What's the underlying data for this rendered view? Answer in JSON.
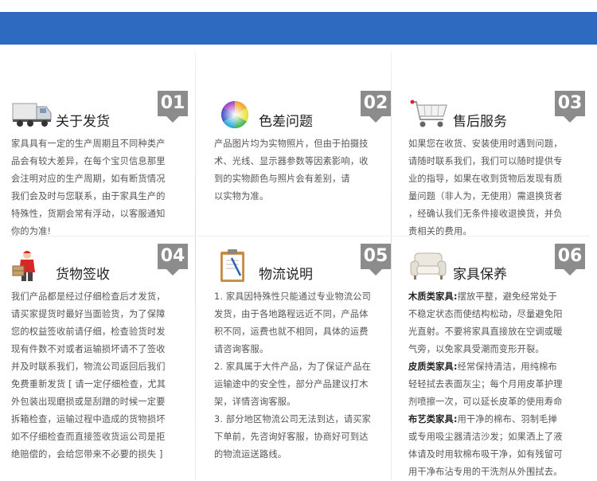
{
  "cards": [
    {
      "num": "01",
      "title": "关于发货",
      "icon": "truck-icon",
      "lines": [
        "家具具有一定的生产周期且不同种类产",
        "品会有较大差异，在每个宝贝信息那里",
        "会注明对应的生产周期，如有断货情况",
        "我们会及时与您联系，由于家具生产的",
        "特殊性，货期会常有浮动，以客服通知",
        "你的为准!"
      ]
    },
    {
      "num": "02",
      "title": "色差问题",
      "icon": "color-wheel-icon",
      "lines": [
        "产品图片均为实物照片，但由于拍摄技",
        "术、光线、显示器参数等因素影响，收",
        "到的实物颜色与照片会有差别，请",
        "以实物为准。"
      ]
    },
    {
      "num": "03",
      "title": "售后服务",
      "icon": "shopping-cart-icon",
      "lines": [
        "如果您在收货、安装使用时遇到问题，",
        "请随时联系我们，我们可以随时提供专",
        "业的指导，如果在收到货物后发现有质",
        "量问题（非人为，无使用）需退换货者",
        "，经确认我们无条件接收退换货，并负",
        "责相关的费用。"
      ]
    },
    {
      "num": "04",
      "title": "货物签收",
      "icon": "delivery-man-icon",
      "lines": [
        "我们产品都是经过仔细检查后才发货，",
        "请买家提货时最好当面验货，为了保障",
        "您的权益签收前请仔细，检查验货时发",
        "现有件数不对或者运输损坏请不了签收",
        "并及时联系我们，物流公司返回后我们",
        "免费重新发货 [ 请一定仔细检查，尤其",
        "外包装出现磨损或是刮蹭的时候一定要",
        "拆箱检查，运输过程中造成的货物损坏",
        "如不仔细检查而直接签收货运公司是拒",
        "绝赔偿的，会给您带来不必要的损失 ]"
      ]
    },
    {
      "num": "05",
      "title": "物流说明",
      "icon": "clipboard-icon",
      "lines": [
        "1. 家具因特殊性只能通过专业物流公司",
        "发货，由于各地路程远近不同，产品体",
        "积不同，运费也就不相同，具体的运费",
        "请咨询客服。",
        "2. 家具属于大件产品，为了保证产品在",
        "运输途中的安全性，部分产品建议打木",
        "架，详情咨询客服。",
        "3. 部分地区物流公司无法到达，请买家",
        "下单前，先咨询好客服，协商好可到达",
        "的物流运送路线。"
      ]
    },
    {
      "num": "06",
      "title": "家具保养",
      "icon": "armchair-icon",
      "sections": [
        {
          "label": "木质类家具:",
          "lines": [
            "摆放平整，避免经常处于",
            "不稳定状态而使结构松动，尽量避免阳",
            "光直射。不要将家具直接放在空调或暖",
            "气旁，以免家具受潮而变形开裂。"
          ]
        },
        {
          "label": "皮质类家具:",
          "lines": [
            "经常保持清洁，用纯棉布",
            "轻轻拭去表面灰尘；每个月用皮革护理",
            "剂喷擦一次，可以延长皮革的使用寿命"
          ]
        },
        {
          "label": "布艺类家具:",
          "lines": [
            "用干净的棉布、羽制毛掸",
            "或专用吸尘器清洁沙发；如果洒上了液",
            "体请及时用软棉布吸干净，如有残留可",
            "用干净布沾专用的干洗剂从外围拭去。"
          ]
        }
      ]
    }
  ]
}
